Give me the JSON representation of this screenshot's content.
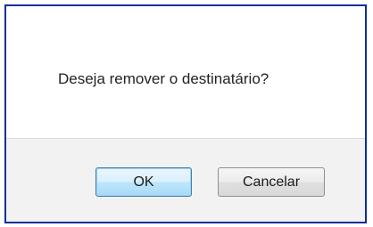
{
  "dialog": {
    "message": "Deseja remover o destinatário?",
    "ok_label": "OK",
    "cancel_label": "Cancelar"
  },
  "colors": {
    "border": "#0a2f9c",
    "footer_background": "#f2f2f2",
    "default_button_border": "#3c7fb1"
  }
}
